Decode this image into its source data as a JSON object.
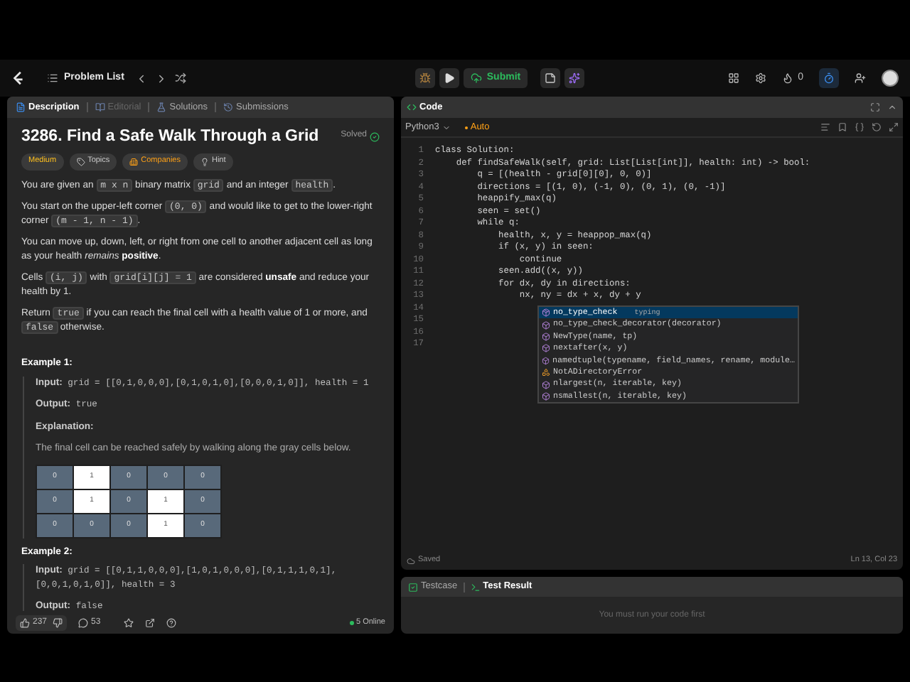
{
  "topbar": {
    "problem_list": "Problem List",
    "submit": "Submit",
    "streak": "0"
  },
  "left": {
    "tabs": [
      {
        "label": "Description",
        "selected": true,
        "disabled": false
      },
      {
        "label": "Editorial",
        "selected": false,
        "disabled": true
      },
      {
        "label": "Solutions",
        "selected": false,
        "disabled": false
      },
      {
        "label": "Submissions",
        "selected": false,
        "disabled": false
      }
    ],
    "title": "3286. Find a Safe Walk Through a Grid",
    "status": "Solved",
    "tags": [
      {
        "kind": "difficulty",
        "label": "Medium"
      },
      {
        "kind": "topics",
        "label": "Topics"
      },
      {
        "kind": "companies",
        "label": "Companies"
      },
      {
        "kind": "hint",
        "label": "Hint"
      }
    ],
    "paragraphs": [
      [
        {
          "kind": "text",
          "text": "You are given an "
        },
        {
          "kind": "code",
          "text": "m x n"
        },
        {
          "kind": "text",
          "text": " binary matrix "
        },
        {
          "kind": "code",
          "text": "grid"
        },
        {
          "kind": "text",
          "text": " and an integer "
        },
        {
          "kind": "code",
          "text": "health"
        },
        {
          "kind": "text",
          "text": "."
        }
      ],
      [
        {
          "kind": "text",
          "text": "You start on the upper-left corner "
        },
        {
          "kind": "code",
          "text": "(0, 0)"
        },
        {
          "kind": "text",
          "text": " and would like to get to the lower-right corner "
        },
        {
          "kind": "code",
          "text": "(m - 1, n - 1)"
        },
        {
          "kind": "text",
          "text": "."
        }
      ],
      [
        {
          "kind": "text",
          "text": "You can move up, down, left, or right from one cell to another adjacent cell as long as your health "
        },
        {
          "kind": "italic",
          "text": "remains "
        },
        {
          "kind": "bold",
          "text": "positive"
        },
        {
          "kind": "text",
          "text": "."
        }
      ],
      [
        {
          "kind": "text",
          "text": "Cells "
        },
        {
          "kind": "code",
          "text": "(i, j)"
        },
        {
          "kind": "text",
          "text": " with "
        },
        {
          "kind": "code",
          "text": "grid[i][j] = 1"
        },
        {
          "kind": "text",
          "text": " are considered "
        },
        {
          "kind": "bold",
          "text": "unsafe"
        },
        {
          "kind": "text",
          "text": " and reduce your health by 1."
        }
      ],
      [
        {
          "kind": "text",
          "text": "Return "
        },
        {
          "kind": "code",
          "text": "true"
        },
        {
          "kind": "text",
          "text": " if you can reach the final cell with a health value of 1 or more, and "
        },
        {
          "kind": "code",
          "text": "false"
        },
        {
          "kind": "text",
          "text": " otherwise."
        }
      ]
    ],
    "examples": [
      {
        "title": "Example 1:",
        "lines": [
          {
            "label": "Input:",
            "value": "grid = [[0,1,0,0,0],[0,1,0,1,0],[0,0,0,1,0]], health = 1"
          },
          {
            "label": "Output:",
            "value": "true"
          },
          {
            "label": "Explanation:"
          }
        ],
        "note": "The final cell can be reached safely by walking along the gray cells below.",
        "grid": [
          [
            {
              "value": "0",
              "kind": "safe"
            },
            {
              "value": "1",
              "kind": "unsafe"
            },
            {
              "value": "0",
              "kind": "safe"
            },
            {
              "value": "0",
              "kind": "safe"
            },
            {
              "value": "0",
              "kind": "safe"
            }
          ],
          [
            {
              "value": "0",
              "kind": "safe"
            },
            {
              "value": "1",
              "kind": "unsafe"
            },
            {
              "value": "0",
              "kind": "safe"
            },
            {
              "value": "1",
              "kind": "unsafe"
            },
            {
              "value": "0",
              "kind": "safe"
            }
          ],
          [
            {
              "value": "0",
              "kind": "safe"
            },
            {
              "value": "0",
              "kind": "safe"
            },
            {
              "value": "0",
              "kind": "safe"
            },
            {
              "value": "1",
              "kind": "unsafe"
            },
            {
              "value": "0",
              "kind": "safe"
            }
          ]
        ]
      },
      {
        "title": "Example 2:",
        "lines": [
          {
            "label": "Input:",
            "value": "grid = [[0,1,1,0,0,0],[1,0,1,0,0,0],[0,1,1,1,0,1],[0,0,1,0,1,0]], health = 3"
          },
          {
            "label": "Output:",
            "value": "false"
          }
        ]
      }
    ],
    "footer": {
      "likes": "237",
      "comments": "53",
      "online": "5 Online"
    }
  },
  "code": {
    "title": "Code",
    "language": "Python3",
    "mode": "Auto",
    "lines": [
      {
        "number": "1",
        "text": "class Solution:"
      },
      {
        "number": "2",
        "text": "    def findSafeWalk(self, grid: List[List[int]], health: int) -> bool:"
      },
      {
        "number": "3",
        "text": "        q = [(health - grid[0][0], 0, 0)]"
      },
      {
        "number": "4",
        "text": "        directions = [(1, 0), (-1, 0), (0, 1), (0, -1)]"
      },
      {
        "number": "5",
        "text": "        heappify_max(q)"
      },
      {
        "number": "6",
        "text": "        seen = set()"
      },
      {
        "number": "7",
        "text": "        while q:"
      },
      {
        "number": "8",
        "text": "            health, x, y = heappop_max(q)"
      },
      {
        "number": "9",
        "text": "            if (x, y) in seen:"
      },
      {
        "number": "10",
        "text": "                continue"
      },
      {
        "number": "11",
        "text": "            seen.add((x, y))"
      },
      {
        "number": "12",
        "text": "            for dx, dy in directions:"
      },
      {
        "number": "13",
        "text": "                nx, ny = dx + x, dy + y"
      },
      {
        "number": "14"
      },
      {
        "number": "15"
      },
      {
        "number": "16"
      },
      {
        "number": "17"
      }
    ],
    "suggestions": [
      {
        "kind": "module",
        "label": "no_type_check",
        "detail": "typing",
        "selected": true
      },
      {
        "kind": "function",
        "label": "no_type_check_decorator(decorator)",
        "selected": false
      },
      {
        "kind": "function",
        "label": "NewType(name, tp)",
        "selected": false
      },
      {
        "kind": "function",
        "label": "nextafter(x, y)",
        "selected": false
      },
      {
        "kind": "function",
        "label": "namedtuple(typename, field_names, rename, module…",
        "selected": false
      },
      {
        "kind": "class",
        "label": "NotADirectoryError",
        "selected": false
      },
      {
        "kind": "function",
        "label": "nlargest(n, iterable, key)",
        "selected": false
      },
      {
        "kind": "function",
        "label": "nsmallest(n, iterable, key)",
        "selected": false
      }
    ],
    "saved": "Saved",
    "cursor": "Ln 13, Col 23"
  },
  "result": {
    "tabs": [
      {
        "label": "Testcase",
        "selected": false
      },
      {
        "label": "Test Result",
        "selected": true
      }
    ],
    "message": "You must run your code first"
  }
}
